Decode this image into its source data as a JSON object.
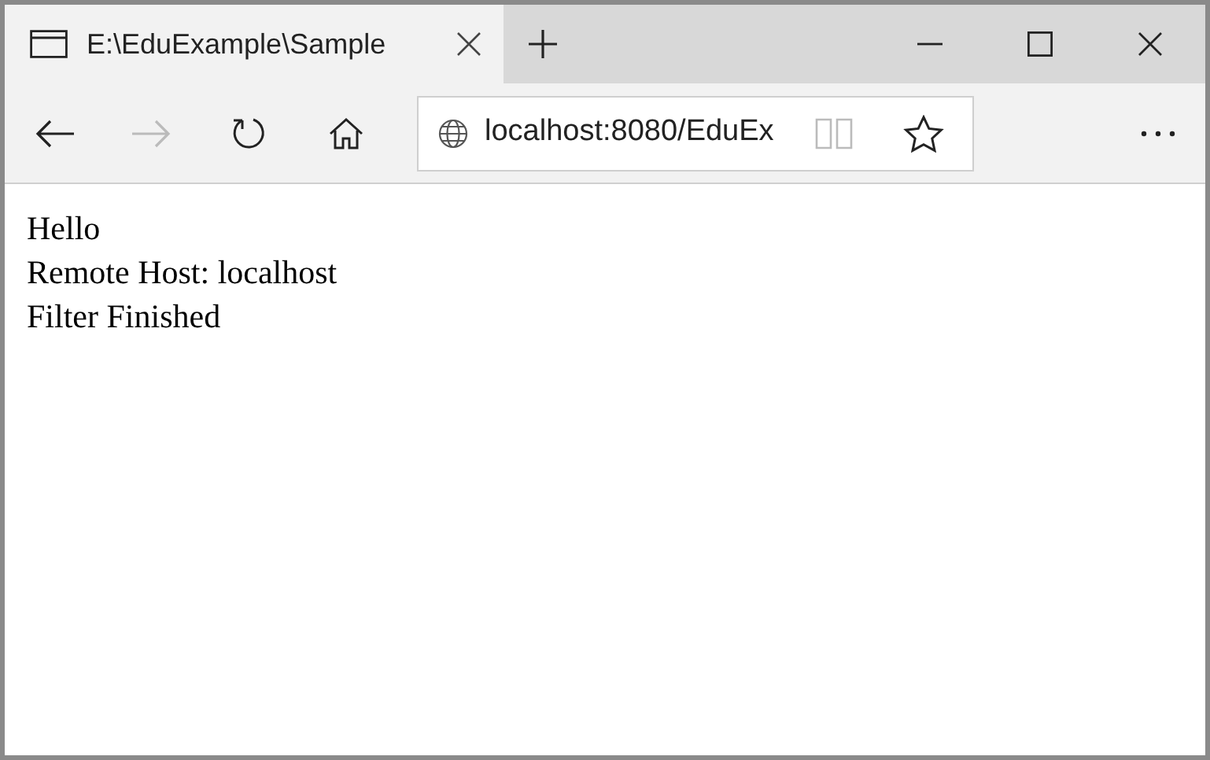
{
  "tabs": [
    {
      "title": "E:\\EduExample\\Sample",
      "selected": true
    }
  ],
  "toolbar": {
    "back": {
      "disabled": false
    },
    "forward": {
      "disabled": true
    },
    "address": "localhost:8080/EduEx"
  },
  "content": {
    "lines": [
      "Hello",
      "Remote Host: localhost",
      "Filter Finished"
    ]
  }
}
